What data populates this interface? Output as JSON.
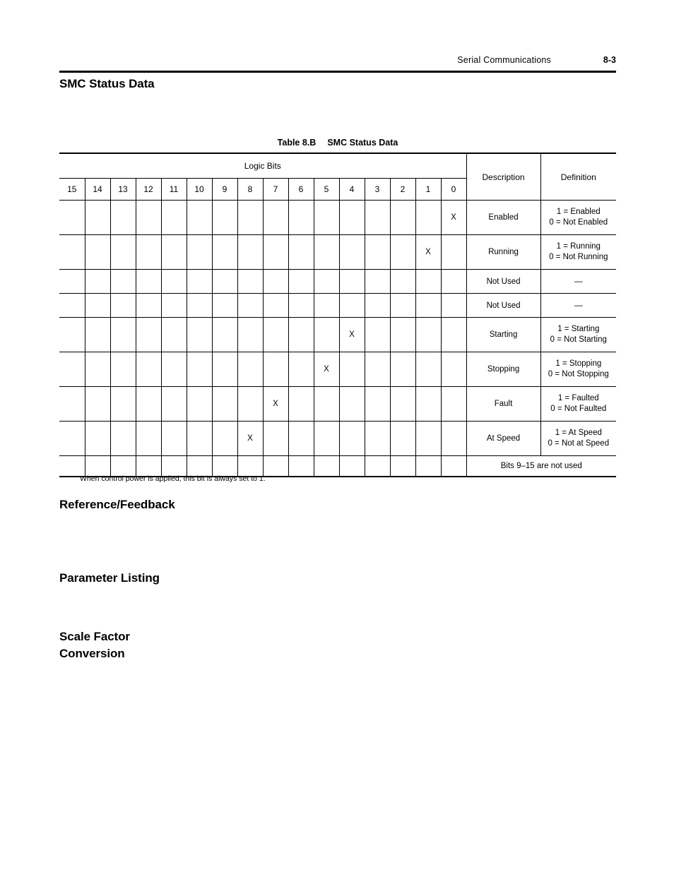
{
  "header": {
    "title": "Serial Communications",
    "page_number": "8-3"
  },
  "headings": {
    "smc_status_data": "SMC Status Data",
    "reference_feedback": "Reference/Feedback",
    "parameter_listing": "Parameter Listing",
    "scale_factor_line1": "Scale Factor",
    "scale_factor_line2": "Conversion"
  },
  "table": {
    "caption_number": "Table 8.B",
    "caption_title": "SMC Status Data",
    "group_header": "Logic Bits",
    "col_description": "Description",
    "col_definition": "Definition",
    "bit_labels": [
      "15",
      "14",
      "13",
      "12",
      "11",
      "10",
      "9",
      "8",
      "7",
      "6",
      "5",
      "4",
      "3",
      "2",
      "1",
      "0"
    ],
    "x_mark": "X",
    "dash": "—",
    "footer_note": "Bits 9–15 are not used",
    "rows": [
      {
        "bit": 0,
        "description": "Enabled",
        "definition_line1": "1 = Enabled",
        "definition_line2": "0 = Not Enabled",
        "size": "tall"
      },
      {
        "bit": 1,
        "description": "Running",
        "definition_line1": "1 = Running",
        "definition_line2": "0 = Not Running",
        "size": "tall"
      },
      {
        "bit": null,
        "description": "Not Used",
        "definition_line1": "—",
        "definition_line2": "",
        "size": "short"
      },
      {
        "bit": null,
        "description": "Not Used",
        "definition_line1": "—",
        "definition_line2": "",
        "size": "short"
      },
      {
        "bit": 4,
        "description": "Starting",
        "definition_line1": "1 = Starting",
        "definition_line2": "0 = Not Starting",
        "size": "tall"
      },
      {
        "bit": 5,
        "description": "Stopping",
        "definition_line1": "1 = Stopping",
        "definition_line2": "0 = Not Stopping",
        "size": "tall"
      },
      {
        "bit": 7,
        "description": "Fault",
        "definition_line1": "1 = Faulted",
        "definition_line2": "0 = Not Faulted",
        "size": "tall"
      },
      {
        "bit": 8,
        "description": "At Speed",
        "definition_line1": "1 = At Speed",
        "definition_line2": "0 = Not at Speed",
        "size": "tall"
      }
    ]
  },
  "footnote": "When control power is applied, this bit is always set to 1."
}
